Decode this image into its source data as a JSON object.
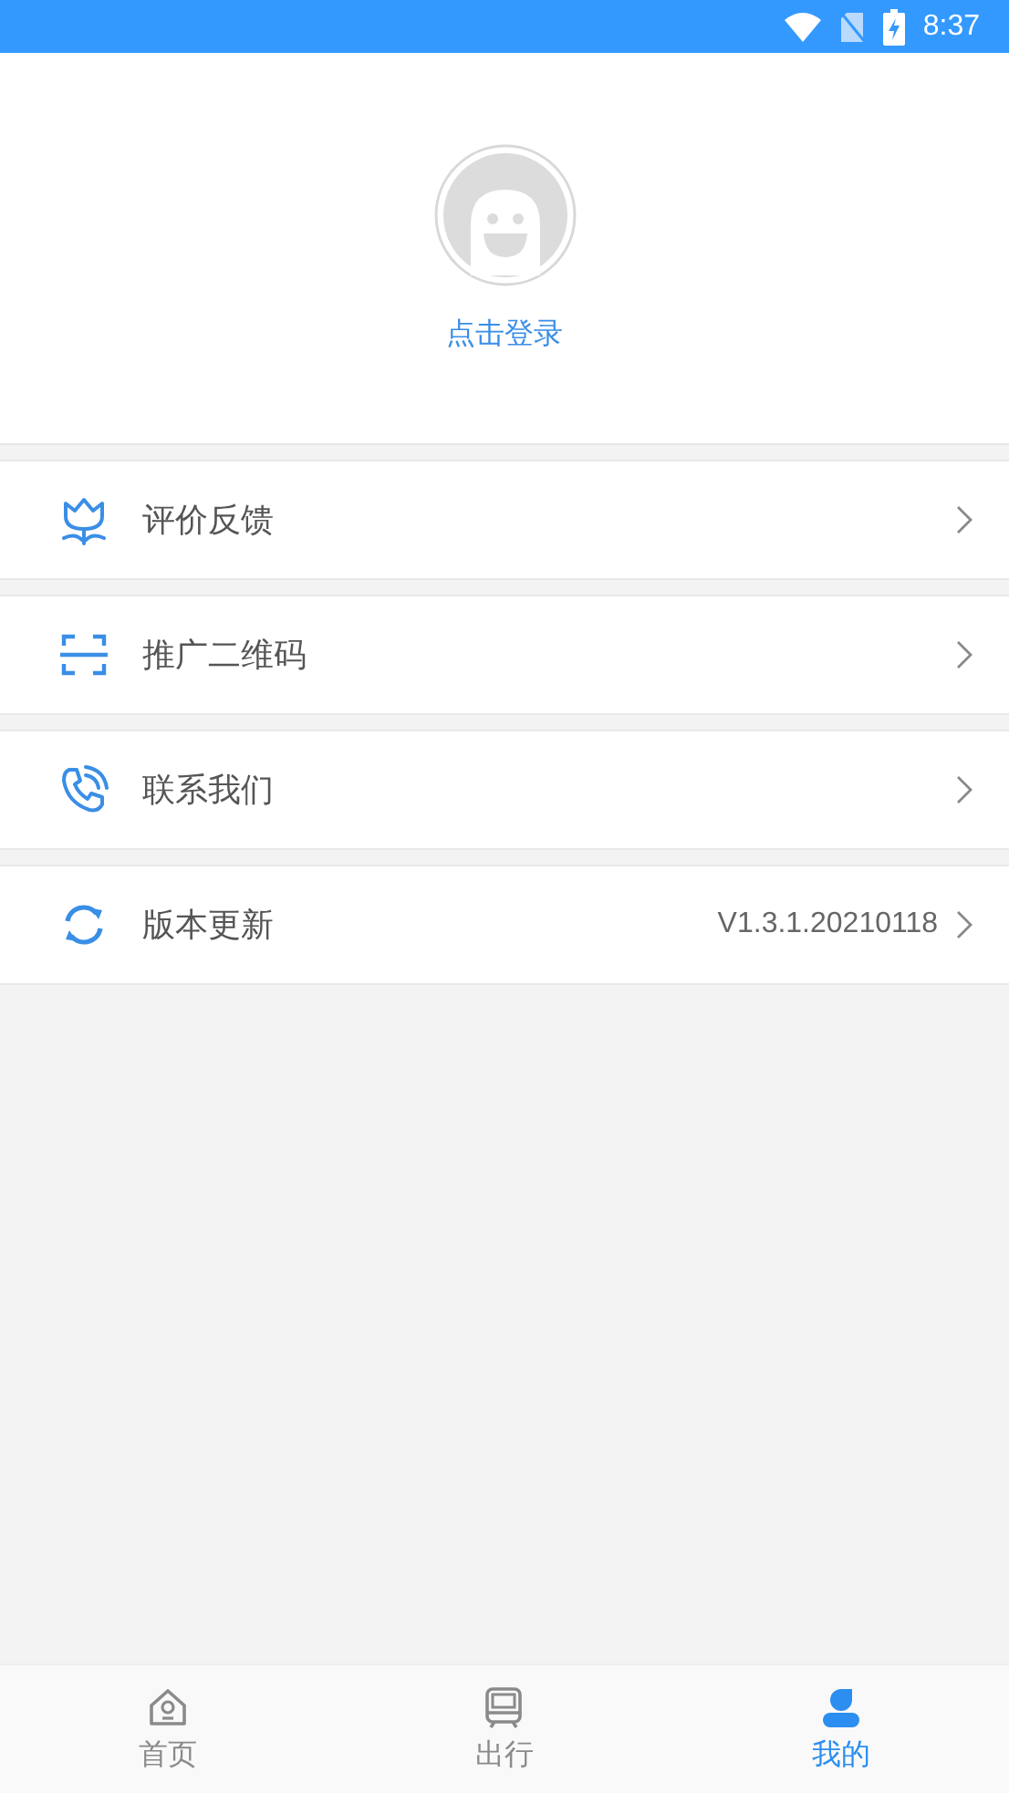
{
  "status_bar": {
    "time": "8:37"
  },
  "profile": {
    "login_label": "点击登录"
  },
  "menu": [
    {
      "label": "评价反馈"
    },
    {
      "label": "推广二维码"
    },
    {
      "label": "联系我们"
    },
    {
      "label": "版本更新",
      "value": "V1.3.1.20210118"
    }
  ],
  "tab_bar": [
    {
      "label": "首页",
      "selected": false
    },
    {
      "label": "出行",
      "selected": false
    },
    {
      "label": "我的",
      "selected": true
    }
  ]
}
